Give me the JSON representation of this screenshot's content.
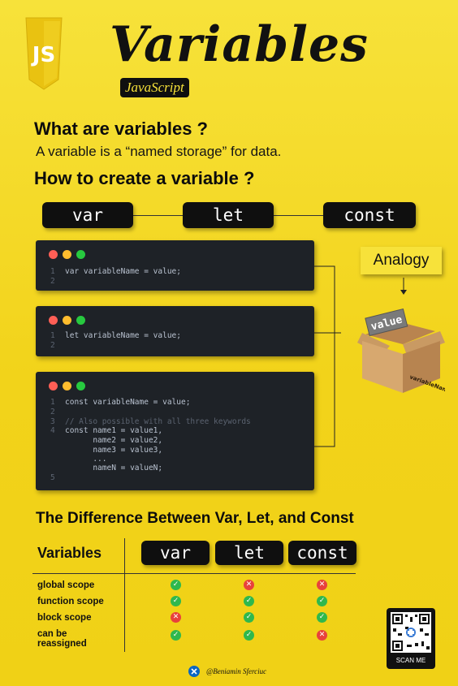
{
  "header": {
    "logo_text": "JS",
    "title": "Variables",
    "subtitle": "JavaScript"
  },
  "intro": {
    "question1": "What are variables ?",
    "answer1": "A variable is a “named storage” for data.",
    "question2": "How to create a variable ?"
  },
  "keywords": [
    "var",
    "let",
    "const"
  ],
  "code_windows": [
    {
      "lines": [
        {
          "n": "1",
          "text": "var variableName = value;"
        },
        {
          "n": "2",
          "text": ""
        }
      ]
    },
    {
      "lines": [
        {
          "n": "1",
          "text": "let variableName = value;"
        },
        {
          "n": "2",
          "text": ""
        }
      ]
    },
    {
      "lines": [
        {
          "n": "1",
          "text": "const variableName = value;"
        },
        {
          "n": "2",
          "text": ""
        },
        {
          "n": "3",
          "text": "// Also possible with all three keywords"
        },
        {
          "n": "4",
          "text": "const name1 = value1,"
        },
        {
          "n": "",
          "text": "      name2 = value2,"
        },
        {
          "n": "",
          "text": "      name3 = value3,"
        },
        {
          "n": "",
          "text": "      ..."
        },
        {
          "n": "",
          "text": "      nameN = valueN;"
        },
        {
          "n": "5",
          "text": ""
        }
      ]
    }
  ],
  "analogy": {
    "label": "Analogy",
    "box_tag": "value",
    "box_side_label": "variableName"
  },
  "difference": {
    "title": "The Difference Between Var, Let, and Const",
    "row_header": "Variables",
    "columns": [
      "var",
      "let",
      "const"
    ],
    "rows": [
      {
        "label": "global scope",
        "values": [
          true,
          false,
          false
        ]
      },
      {
        "label": "function scope",
        "values": [
          true,
          true,
          true
        ]
      },
      {
        "label": "block scope",
        "values": [
          false,
          true,
          true
        ]
      },
      {
        "label": "can be reassigned",
        "values": [
          true,
          true,
          false
        ]
      }
    ]
  },
  "footer": {
    "author": "@Beniamin Sferciuc",
    "scan_label": "SCAN ME"
  },
  "colors": {
    "background": "#f2d31a",
    "dot_red": "#ff5f56",
    "dot_yellow": "#ffbd2e",
    "dot_green": "#27c93f",
    "check_green": "#2fb84d",
    "cross_red": "#e8413c"
  }
}
